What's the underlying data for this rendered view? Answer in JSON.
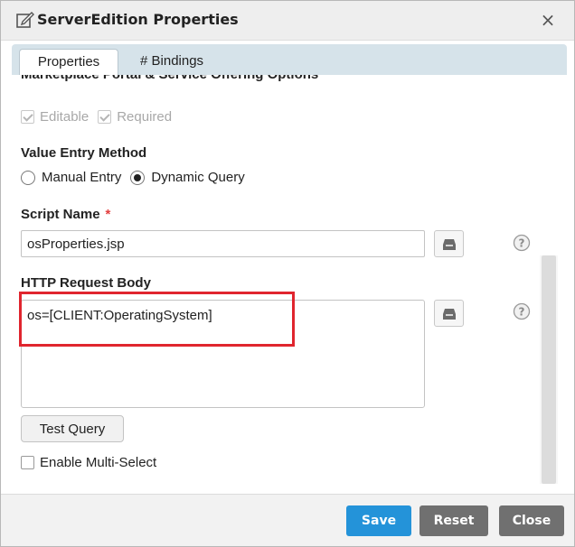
{
  "window": {
    "title": "ServerEdition Properties",
    "title_icon": "edit-icon",
    "close_glyph": "×"
  },
  "tabs": [
    {
      "label": "Properties",
      "active": true
    },
    {
      "label": "# Bindings",
      "active": false
    }
  ],
  "marketplace": {
    "heading": "Marketplace Portal & Service Offering Options",
    "editable_label": "Editable",
    "editable_checked": true,
    "required_label": "Required",
    "required_checked": true
  },
  "value_entry": {
    "label": "Value Entry Method",
    "options": [
      "Manual Entry",
      "Dynamic Query"
    ],
    "selected": "Dynamic Query"
  },
  "script_name": {
    "label": "Script Name",
    "required_marker": "*",
    "value": "osProperties.jsp"
  },
  "http_body": {
    "label": "HTTP Request Body",
    "value": "os=[CLIENT:OperatingSystem]"
  },
  "test_query_label": "Test Query",
  "multi_select": {
    "label": "Enable Multi-Select",
    "checked": false
  },
  "footer": {
    "save_label": "Save",
    "reset_label": "Reset",
    "close_label": "Close"
  },
  "colors": {
    "accent": "#2493d9",
    "secondary_button": "#707070",
    "highlight": "#e0252e",
    "required": "#e23d3d"
  }
}
